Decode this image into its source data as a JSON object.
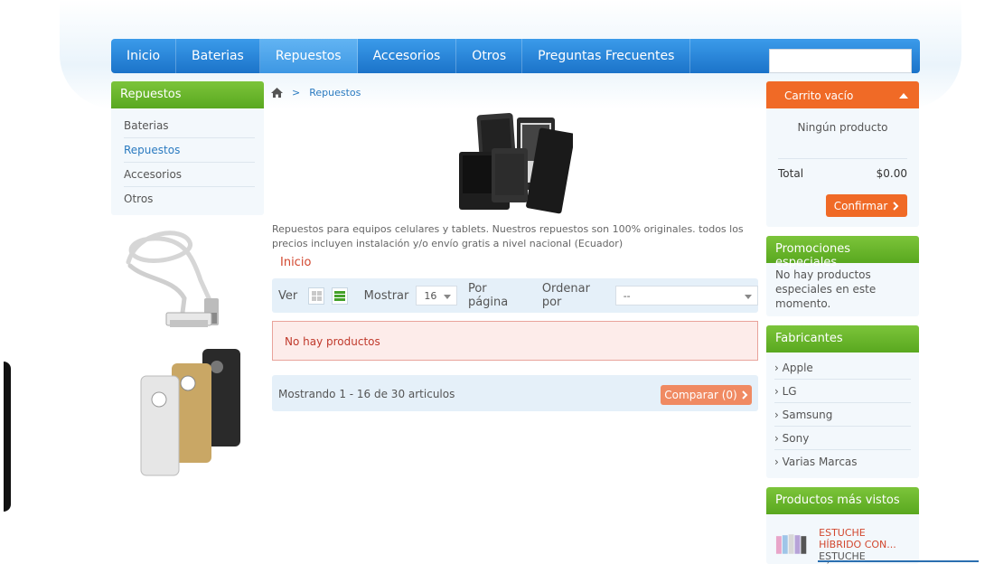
{
  "nav": {
    "items": [
      "Inicio",
      "Baterias",
      "Repuestos",
      "Accesorios",
      "Otros",
      "Preguntas Frecuentes"
    ],
    "active_index": 2,
    "search_value": ""
  },
  "left": {
    "title": "Repuestos",
    "categories": [
      "Baterias",
      "Repuestos",
      "Accesorios",
      "Otros"
    ],
    "active_category": "Repuestos"
  },
  "breadcrumb": {
    "separator": ">",
    "current": "Repuestos"
  },
  "category": {
    "description": "Repuestos para equipos celulares y tablets. Nuestros repuestos son 100% originales. todos los precios incluyen instalación y/o envío gratis a nivel nacional (Ecuador)",
    "link": "Inicio"
  },
  "toolbar": {
    "view_label": "Ver",
    "show_label": "Mostrar",
    "show_value": "16",
    "per_page_label": "Por página",
    "sort_label": "Ordenar por",
    "sort_value": "--"
  },
  "alert": {
    "text": "No hay productos"
  },
  "pager": {
    "text": "Mostrando 1 - 16 de 30 articulos",
    "compare_label": "Comparar (0)"
  },
  "cart": {
    "title": "Carrito  vacío",
    "empty_text": "Ningún producto",
    "total_label": "Total",
    "total_value": "$0.00",
    "confirm_label": "Confirmar"
  },
  "promos": {
    "title": "Promociones especiales",
    "text": "No hay productos especiales en este momento."
  },
  "manufacturers": {
    "title": "Fabricantes",
    "items": [
      "Apple",
      "LG",
      "Samsung",
      "Sony",
      "Varias Marcas"
    ]
  },
  "viewed": {
    "title": "Productos más vistos",
    "item_name": "ESTUCHE HÍBRIDO CON...",
    "item_sub": "ESTUCHE HÍBRIDO"
  },
  "colors": {
    "nav_blue": "#1b73c9",
    "green_header": "#59a81f",
    "orange": "#f06a26",
    "link_blue": "#2a7ac0",
    "alert_red": "#c0392b"
  }
}
